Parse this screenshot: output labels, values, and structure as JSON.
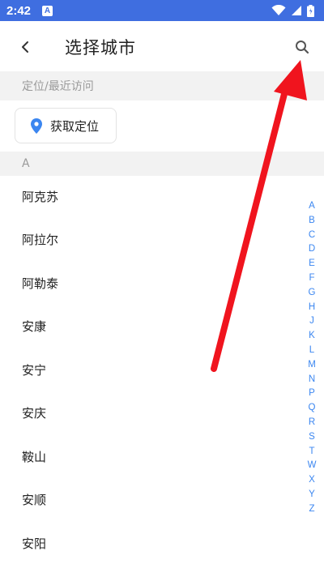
{
  "status_bar": {
    "time": "2:42",
    "notification_icon": "A",
    "icons": [
      "wifi-icon",
      "signal-icon",
      "battery-icon"
    ]
  },
  "header": {
    "title": "选择城市",
    "back_icon": "chevron-left-icon",
    "search_icon": "search-icon"
  },
  "location_section": {
    "title": "定位/最近访问",
    "locate_button": "获取定位",
    "locate_icon": "map-pin-icon"
  },
  "letter_section": {
    "title": "A"
  },
  "cities": [
    "阿克苏",
    "阿拉尔",
    "阿勒泰",
    "安康",
    "安宁",
    "安庆",
    "鞍山",
    "安顺",
    "安阳"
  ],
  "index_letters": [
    "A",
    "B",
    "C",
    "D",
    "E",
    "F",
    "G",
    "H",
    "J",
    "K",
    "L",
    "M",
    "N",
    "P",
    "Q",
    "R",
    "S",
    "T",
    "W",
    "X",
    "Y",
    "Z"
  ],
  "colors": {
    "status_bar": "#3f6ee0",
    "section_bg": "#f2f2f2",
    "index_letters": "#3b86f0",
    "pin": "#3b86f0",
    "annotation_arrow": "#f0141e"
  }
}
